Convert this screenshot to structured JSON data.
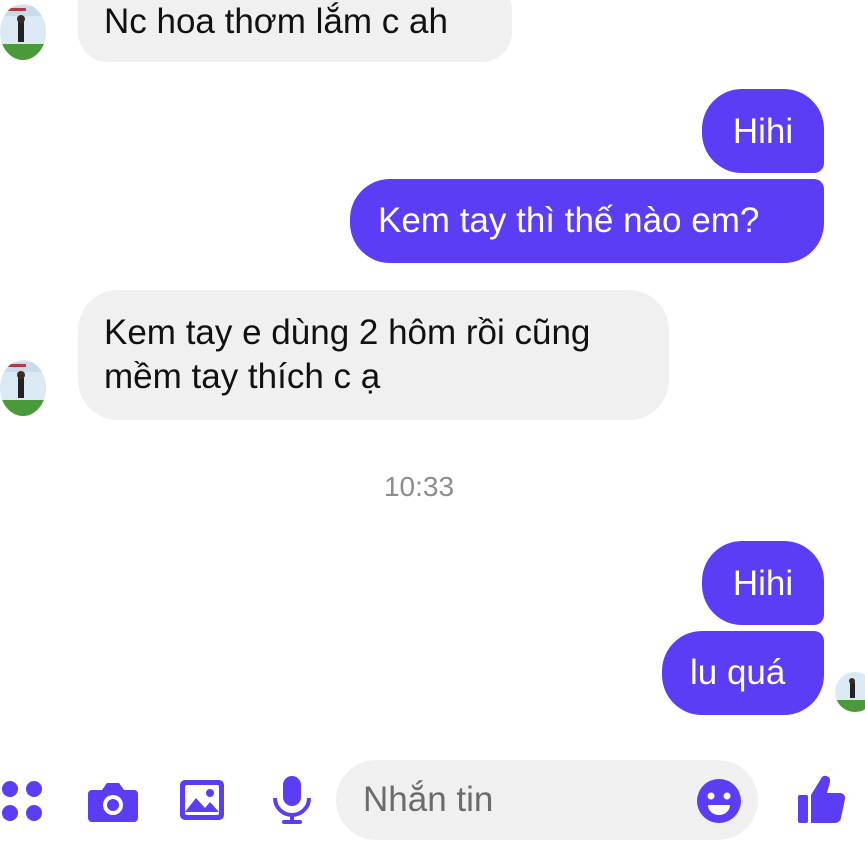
{
  "conversation": {
    "messages": [
      {
        "sender": "contact",
        "text": "Nc hoa thơm lắm c ah"
      },
      {
        "sender": "me",
        "text": "Hihi"
      },
      {
        "sender": "me",
        "text": "Kem tay thì thế nào em?"
      },
      {
        "sender": "contact",
        "lines": [
          "Kem tay e dùng 2 hôm rồi cũng",
          "mềm tay thích c ạ"
        ]
      },
      {
        "sender": "me",
        "text": "Hihi"
      },
      {
        "sender": "me",
        "text": "lu quá"
      }
    ],
    "timestamp": "10:33"
  },
  "composer": {
    "placeholder": "Nhắn tin",
    "icons": [
      "apps-grid-icon",
      "camera-icon",
      "gallery-icon",
      "microphone-icon",
      "emoji-icon",
      "thumbs-up-icon"
    ]
  },
  "colors": {
    "outgoing_bubble": "#5b3df5",
    "incoming_bubble": "#f1f0f0",
    "accent_icons": "#5b3df5",
    "timestamp": "#8d8d8d"
  }
}
